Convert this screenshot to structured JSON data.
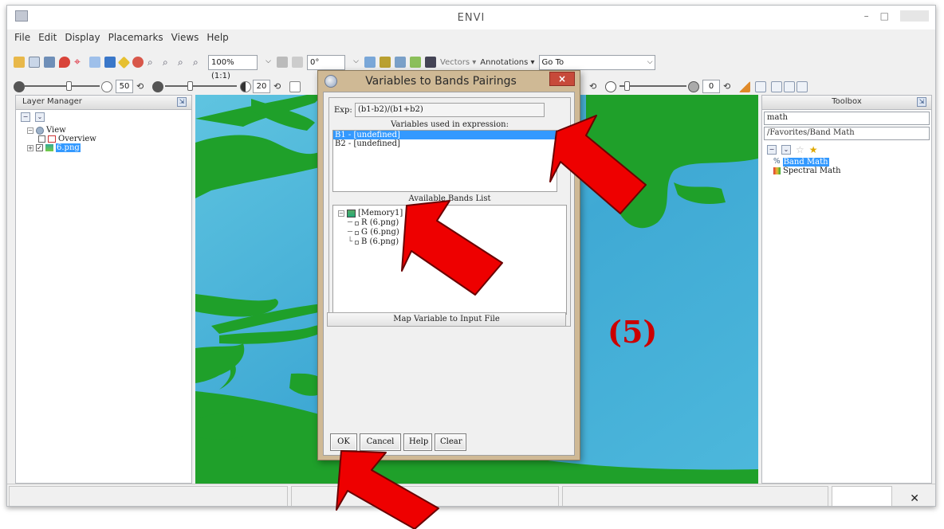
{
  "window": {
    "title": "ENVI"
  },
  "menu": [
    "File",
    "Edit",
    "Display",
    "Placemarks",
    "Views",
    "Help"
  ],
  "toolbar": {
    "zoom_value": "100% (1:1)",
    "rotation_value": "0°",
    "vectors_label": "Vectors ▾",
    "annotations_label": "Annotations ▾",
    "goto_value": "Go To",
    "slider1_value": "50",
    "slider2_value": "20",
    "slider3_value": "0"
  },
  "layer_manager": {
    "title": "Layer Manager",
    "tree": {
      "view_label": "View",
      "overview_label": "Overview",
      "layer_label": "6.png"
    }
  },
  "toolbox": {
    "title": "Toolbox",
    "search_value": "math",
    "path_value": "/Favorites/Band Math",
    "items": [
      "Band Math",
      "Spectral Math"
    ]
  },
  "dialog": {
    "title": "Variables to Bands Pairings",
    "exp_label": "Exp:",
    "expression": "(b1-b2)/(b1+b2)",
    "variables_heading": "Variables used in expression:",
    "variables": [
      "B1 - [undefined]",
      "B2 - [undefined]"
    ],
    "bands_heading": "Available Bands List",
    "bands_root": "[Memory1]",
    "bands": [
      "R (6.png)",
      "G (6.png)",
      "B (6.png)"
    ],
    "map_button": "Map Variable to Input File",
    "buttons": {
      "ok": "OK",
      "cancel": "Cancel",
      "help": "Help",
      "clear": "Clear"
    },
    "close_glyph": "×"
  },
  "annotation": {
    "step_label": "(5)",
    "arrow_color": "#ee0000"
  },
  "colors": {
    "water": "#48b6d8",
    "land": "#1fa02a",
    "selection": "#3399ff",
    "dialog_frame": "#cfb995"
  }
}
